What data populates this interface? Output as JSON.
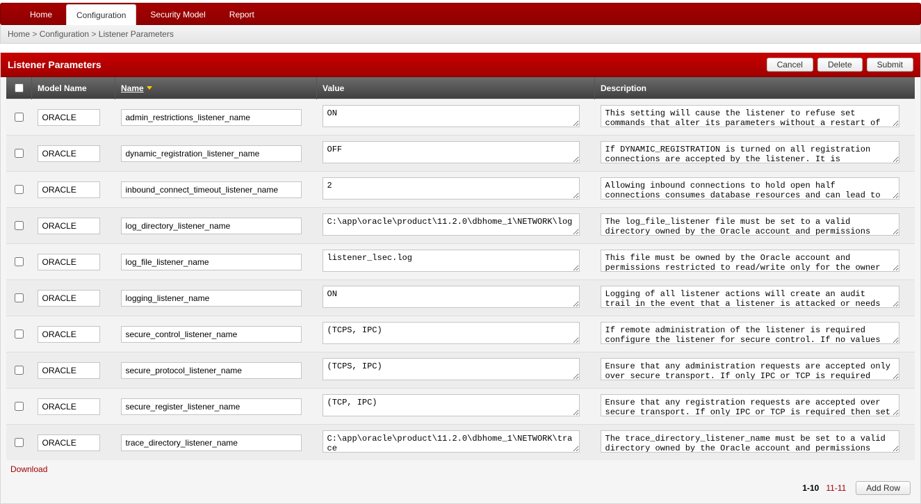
{
  "tabs": {
    "home": "Home",
    "configuration": "Configuration",
    "security_model": "Security Model",
    "report": "Report"
  },
  "breadcrumb": {
    "home": "Home",
    "sep": " > ",
    "configuration": "Configuration",
    "current": "Listener Parameters"
  },
  "panel": {
    "title": "Listener Parameters",
    "buttons": {
      "cancel": "Cancel",
      "delete": "Delete",
      "submit": "Submit"
    }
  },
  "columns": {
    "model": "Model Name",
    "name": "Name",
    "value": "Value",
    "description": "Description"
  },
  "rows": [
    {
      "model": "ORACLE",
      "name": "admin_restrictions_listener_name",
      "value": "ON",
      "description": "This setting will cause the listener to refuse set commands that alter its parameters without a restart of the listener."
    },
    {
      "model": "ORACLE",
      "name": "dynamic_registration_listener_name",
      "value": "OFF",
      "description": "If DYNAMIC_REGISTRATION is turned on all registration connections are accepted by the listener. It is recommended"
    },
    {
      "model": "ORACLE",
      "name": "inbound_connect_timeout_listener_name",
      "value": "2",
      "description": "Allowing inbound connections to hold open half connections consumes database resources and can lead to denial of service."
    },
    {
      "model": "ORACLE",
      "name": "log_directory_listener_name",
      "value": "C:\\app\\oracle\\product\\11.2.0\\dbhome_1\\NETWORK\\log",
      "description": "The log_file_listener file must be set to a valid directory owned by the Oracle account and permissions restricted to"
    },
    {
      "model": "ORACLE",
      "name": "log_file_listener_name",
      "value": "listener_lsec.log",
      "description": "This file must be owned by the Oracle account and permissions restricted to read/write only for the owner and dba group."
    },
    {
      "model": "ORACLE",
      "name": "logging_listener_name",
      "value": "ON",
      "description": "Logging of all listener actions will create an audit trail in the event that a listener is attacked or needs to be debugged."
    },
    {
      "model": "ORACLE",
      "name": "secure_control_listener_name",
      "value": "(TCPS, IPC)",
      "description": "If remote administration of the listener is required configure the listener for secure control. If no values are"
    },
    {
      "model": "ORACLE",
      "name": "secure_protocol_listener_name",
      "value": "(TCPS, IPC)",
      "description": "Ensure that any administration requests are accepted only over secure transport. If only IPC or TCP is required then"
    },
    {
      "model": "ORACLE",
      "name": "secure_register_listener_name",
      "value": "(TCP, IPC)",
      "description": "Ensure that any registration requests are accepted over secure transport. If only IPC or TCP is required then set the"
    },
    {
      "model": "ORACLE",
      "name": "trace_directory_listener_name",
      "value": "C:\\app\\oracle\\product\\11.2.0\\dbhome_1\\NETWORK\\trace",
      "description": "The trace_directory_listener_name must be set to a valid directory owned by the Oracle account and permissions"
    }
  ],
  "download": "Download",
  "pager": {
    "current": "1-10",
    "other": "11-11"
  },
  "add_row": "Add Row"
}
